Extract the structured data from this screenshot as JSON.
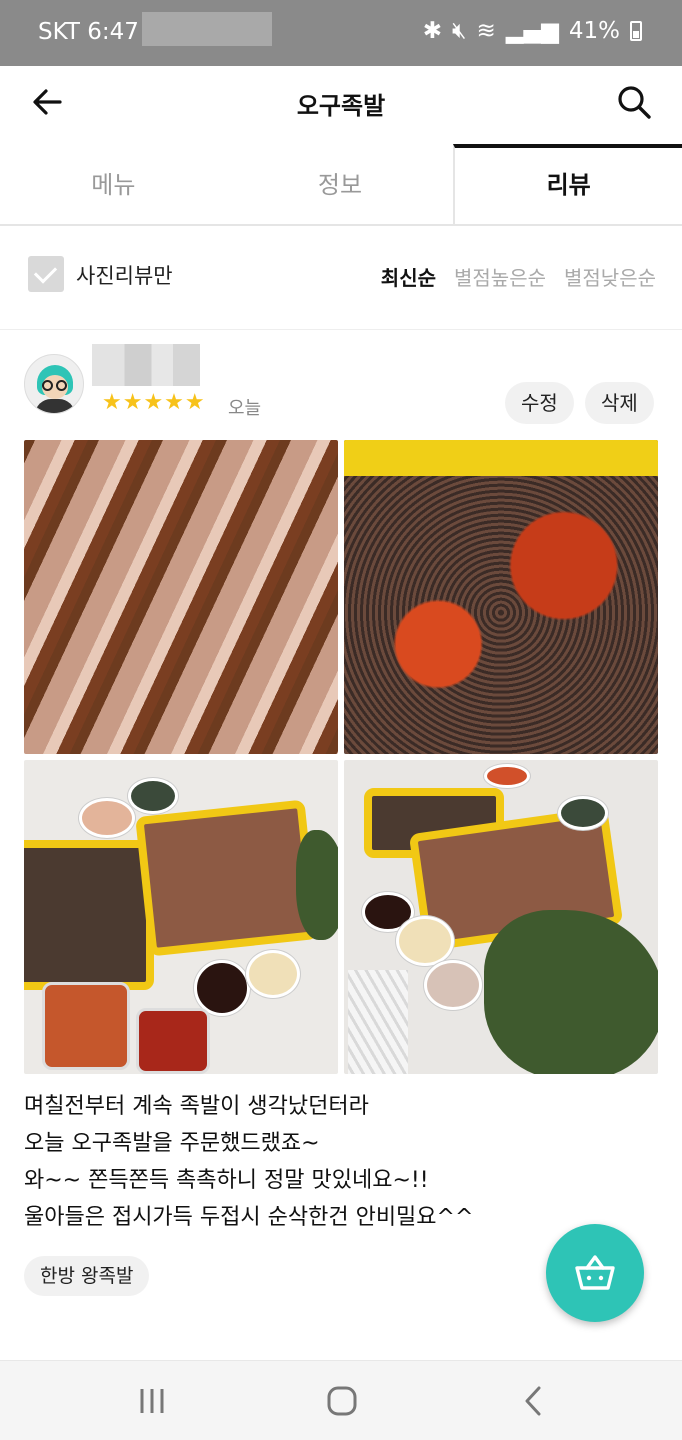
{
  "status_bar": {
    "carrier_time": "SKT 6:47",
    "battery": "41%"
  },
  "header": {
    "title": "오구족발"
  },
  "tabs": [
    {
      "label": "메뉴",
      "active": false
    },
    {
      "label": "정보",
      "active": false
    },
    {
      "label": "리뷰",
      "active": true
    }
  ],
  "filters": {
    "photo_only_label": "사진리뷰만",
    "sorts": [
      "최신순",
      "별점높은순",
      "별점낮은순"
    ],
    "active_sort": "최신순"
  },
  "review": {
    "rating": 5,
    "stars": "★★★★★",
    "date": "오늘",
    "edit_label": "수정",
    "delete_label": "삭제",
    "text_lines": [
      "며칠전부터 계속 족발이 생각났던터라",
      "오늘 오구족발을 주문했드랬죠~",
      "와~~ 쫀득쫀득 촉촉하니 정말 맛있네요~!!",
      "울아들은 접시가득 두접시 순삭한건 안비밀요^^"
    ],
    "menu_tag": "한방 왕족발"
  },
  "colors": {
    "accent": "#2ec4b6",
    "star": "#f7c21a",
    "status_bar": "#8a8a8a"
  },
  "icons": {
    "back": "arrow-left-icon",
    "search": "search-icon",
    "cart": "basket-icon"
  }
}
